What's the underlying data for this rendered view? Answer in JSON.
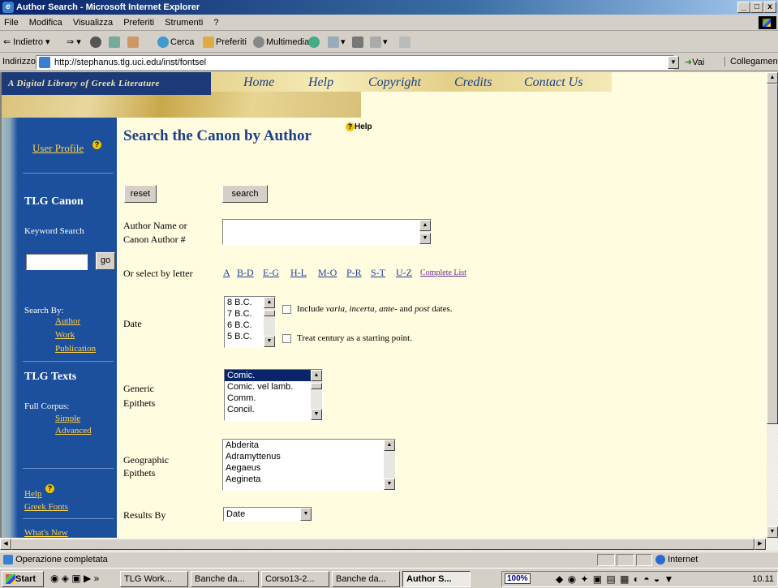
{
  "window": {
    "title": "Author Search - Microsoft Internet Explorer",
    "controls": [
      "_",
      "□",
      "x"
    ]
  },
  "menu": [
    "File",
    "Modifica",
    "Visualizza",
    "Preferiti",
    "Strumenti",
    "?"
  ],
  "toolbar": {
    "back": "Indietro",
    "search": "Cerca",
    "favorites": "Preferiti",
    "multimedia": "Multimedia"
  },
  "address": {
    "label": "Indirizzo",
    "url": "http://stephanus.tlg.uci.edu/inst/fontsel",
    "go": "Vai",
    "links": "Collegamenti"
  },
  "banner": {
    "tagline": "A Digital Library of Greek Literature",
    "nav": [
      "Home",
      "Help",
      "Copyright",
      "Credits",
      "Contact Us"
    ]
  },
  "sidebar": {
    "user_profile": "User Profile",
    "canon_heading": "TLG Canon",
    "keyword_search": "Keyword Search",
    "go": "go",
    "search_by": "Search By:",
    "search_by_links": [
      "Author",
      "Work",
      "Publication"
    ],
    "texts_heading": "TLG Texts",
    "full_corpus": "Full Corpus:",
    "corpus_links": [
      "Simple",
      "Advanced"
    ],
    "help": "Help",
    "greek_fonts": "Greek Fonts",
    "whats_new": "What's New"
  },
  "main": {
    "title": "Search the Canon by Author",
    "help": "Help",
    "reset": "reset",
    "search": "search",
    "author_label_1": "Author Name or",
    "author_label_2": "Canon Author #",
    "select_by_letter": "Or select by letter",
    "letters": [
      "A",
      "B-D",
      "E-G",
      "H-L",
      "M-O",
      "P-R",
      "S-T",
      "U-Z"
    ],
    "complete_list": "Complete List",
    "date_label": "Date",
    "date_options": [
      "8 B.C.",
      "7 B.C.",
      "6 B.C.",
      "5 B.C."
    ],
    "include_text_a": "Include ",
    "include_text_b": "varia, incerta, ante-",
    "include_text_c": " and ",
    "include_text_d": "post",
    "include_text_e": " dates.",
    "treat_century": "Treat century as a starting point.",
    "generic_label_1": "Generic",
    "generic_label_2": "Epithets",
    "generic_options": [
      "Comic.",
      "Comic. vel lamb.",
      "Comm.",
      "Concil."
    ],
    "geographic_label_1": "Geographic",
    "geographic_label_2": "Epithets",
    "geographic_options": [
      "Abderita",
      "Adramyttenus",
      "Aegaeus",
      "Aegineta"
    ],
    "results_label": "Results By",
    "results_value": "Date"
  },
  "status": {
    "text": "Operazione completata",
    "zone": "Internet"
  },
  "taskbar": {
    "start": "Start",
    "tasks": [
      "TLG Work...",
      "Banche da...",
      "Corso13-2...",
      "Banche da...",
      "Author S..."
    ],
    "zoom": "100%",
    "clock": "10.11"
  }
}
